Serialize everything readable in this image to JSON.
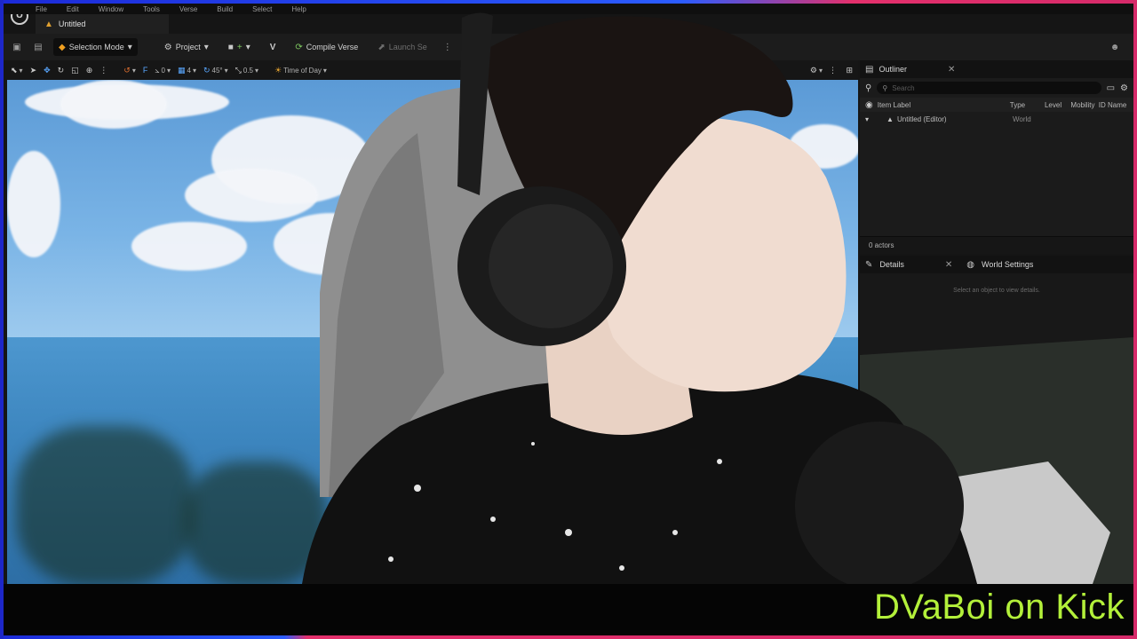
{
  "menu": [
    "File",
    "Edit",
    "Window",
    "Tools",
    "Verse",
    "Build",
    "Select",
    "Help"
  ],
  "tab": {
    "label": "Untitled"
  },
  "toolbar": {
    "selection_mode": "Selection Mode",
    "project": "Project",
    "compile_verse": "Compile Verse",
    "launch_session": "Launch Se",
    "session_partial": "Se"
  },
  "viewport_bar": {
    "snap_rotate": "0",
    "grid": "4",
    "angle": "45°",
    "scale": "0.5",
    "time_of_day": "Time of Day"
  },
  "outliner": {
    "title": "Outliner",
    "search_placeholder": "Search",
    "columns": [
      "Item Label",
      "Type",
      "Level",
      "Mobility",
      "ID Name"
    ],
    "rows": [
      {
        "label": "Untitled (Editor)",
        "type": "World"
      }
    ],
    "footer": "0 actors"
  },
  "details": {
    "title": "Details",
    "world_settings": "World Settings",
    "empty_message": "Select an object to view details."
  },
  "banner": {
    "text": "DVaBoi on Kick",
    "color": "#b3f03a"
  }
}
